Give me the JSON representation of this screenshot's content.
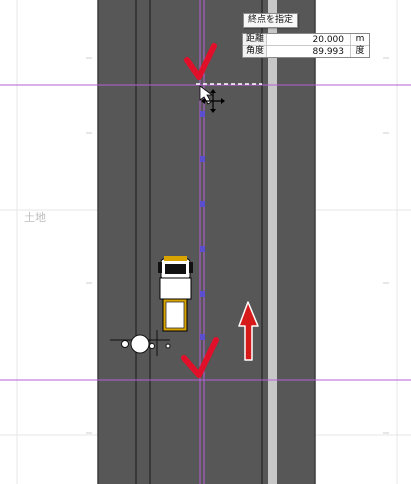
{
  "drawing": {
    "land_label": "土地"
  },
  "hint": {
    "label": "終点を指定"
  },
  "inputs": [
    {
      "label": "距離",
      "value": "20.000",
      "unit": "m"
    },
    {
      "label": "角度",
      "value": "89.993",
      "unit": "度"
    }
  ],
  "colors": {
    "road_surface": "#575757",
    "road_edge": "#3a3a3a",
    "center_stripe": "#c7c7c7",
    "guide_line": "#b65fd8",
    "checkmark": "#e0102a",
    "arrow": "#d61a1a",
    "grid": "#e6e6e6"
  }
}
